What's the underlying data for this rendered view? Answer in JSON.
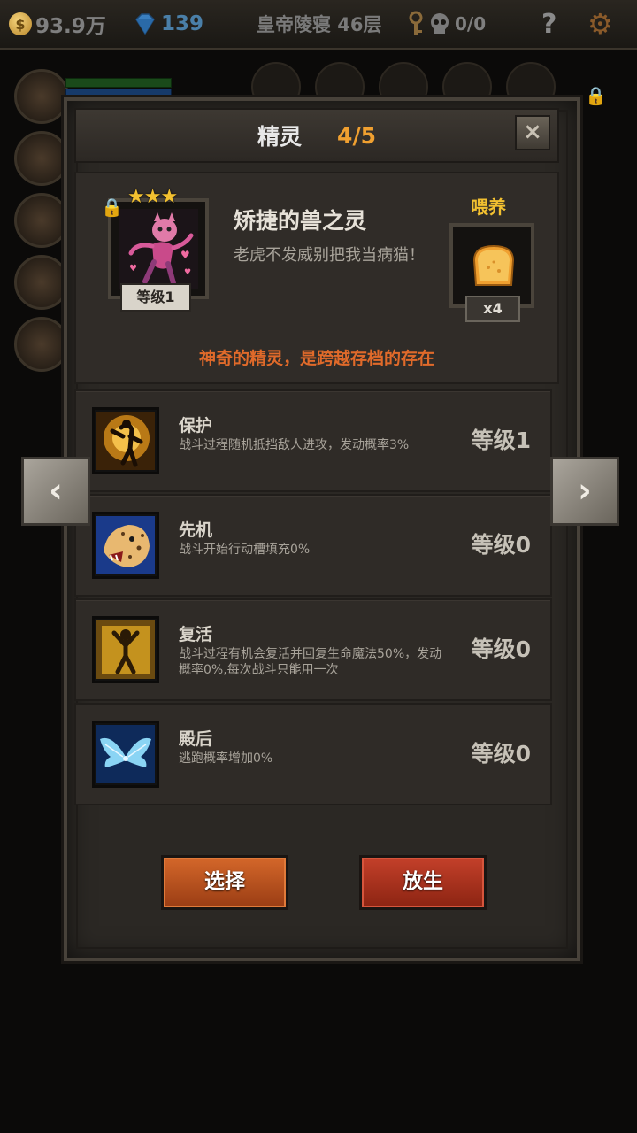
{
  "topbar": {
    "gold": "93.9万",
    "gems": "139",
    "floor": "皇帝陵寝 46层",
    "keys_skulls": "0/0",
    "help": "?"
  },
  "panel": {
    "title": "精灵",
    "count": "4/5",
    "close": "×"
  },
  "spirit": {
    "stars": "★★★",
    "level": "等级1",
    "name": "矫捷的兽之灵",
    "description": "老虎不发威别把我当病猫！",
    "feed_label": "喂养",
    "feed_count": "x4",
    "tagline": "神奇的精灵，是跨越存档的存在"
  },
  "skills": [
    {
      "name": "保护",
      "desc": "战斗过程随机抵挡敌人进攻，发动概率3%",
      "level": "等级1",
      "icon": "shield-dancer-icon"
    },
    {
      "name": "先机",
      "desc": "战斗开始行动槽填充0%",
      "level": "等级0",
      "icon": "leopard-icon"
    },
    {
      "name": "复活",
      "desc": "战斗过程有机会复活并回复生命魔法50%，发动概率0%,每次战斗只能用一次",
      "level": "等级0",
      "icon": "revive-figure-icon"
    },
    {
      "name": "殿后",
      "desc": "逃跑概率增加0%",
      "level": "等级0",
      "icon": "wings-icon"
    }
  ],
  "buttons": {
    "select": "选择",
    "release": "放生"
  },
  "nav": {
    "prev": "‹",
    "next": "›"
  },
  "colors": {
    "accent": "#f0a030",
    "tagline": "#e06a2a",
    "select_button": "#c65a22",
    "release_button": "#b3361e"
  }
}
